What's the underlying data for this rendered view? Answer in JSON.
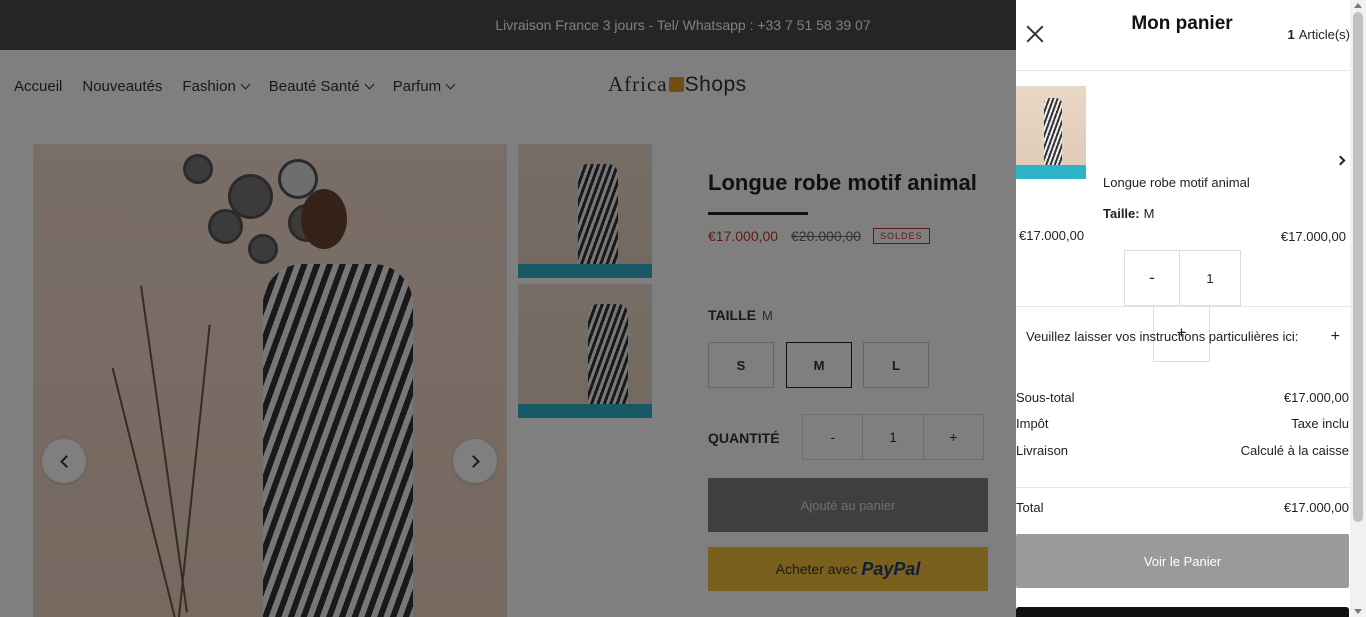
{
  "announcement": "Livraison France 3 jours - Tel/ Whatsapp : +33 7 51 58 39 07",
  "nav": {
    "items": [
      {
        "label": "Accueil",
        "dropdown": false
      },
      {
        "label": "Nouveautés",
        "dropdown": false
      },
      {
        "label": "Fashion",
        "dropdown": true
      },
      {
        "label": "Beauté Santé",
        "dropdown": true
      },
      {
        "label": "Parfum",
        "dropdown": true
      }
    ],
    "logo_left": "Africa",
    "logo_right": "Shops"
  },
  "product": {
    "title": "Longue robe motif animal",
    "price": "€17.000,00",
    "compare_price": "€20.000,00",
    "badge": "SOLDES",
    "size_label": "TAILLE",
    "size_selected": "M",
    "sizes": [
      "S",
      "M",
      "L"
    ],
    "quantity_label": "QUANTITÉ",
    "qty_minus": "-",
    "quantity": "1",
    "qty_plus": "+",
    "add_button": "Ajouté au panier",
    "paypal_prefix": "Acheter avec",
    "paypal_brand": "PayPal"
  },
  "cart": {
    "title": "Mon panier",
    "count": "1",
    "count_label": "Article(s)",
    "item": {
      "name": "Longue robe motif animal",
      "size_label": "Taille:",
      "size_value": "M",
      "unit_price": "€17.000,00",
      "line_total": "€17.000,00",
      "minus": "-",
      "qty": "1",
      "plus": "+"
    },
    "notes_label": "Veuillez laisser vos instructions particulières ici:",
    "notes_toggle": "+",
    "subtotal_label": "Sous-total",
    "subtotal_value": "€17.000,00",
    "tax_label": "Impôt",
    "tax_value": "Taxe inclu",
    "shipping_label": "Livraison",
    "shipping_value": "Calculé à la caisse",
    "total_label": "Total",
    "total_value": "€17.000,00",
    "view_cart_button": "Voir le Panier"
  },
  "colors": {
    "sale_red": "#c0392b",
    "paypal_yellow": "#f3c23b",
    "overlay": "rgba(0,0,0,0.5)"
  }
}
